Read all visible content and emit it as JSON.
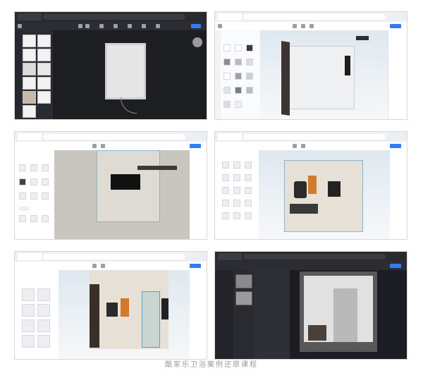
{
  "caption": "酷家乐卫浴案例还原课程",
  "screenshots": [
    {
      "id": "shot-1",
      "theme": "dark",
      "view": "floor-plan-2d"
    },
    {
      "id": "shot-2",
      "theme": "light",
      "view": "3d-walls"
    },
    {
      "id": "shot-3",
      "theme": "light",
      "view": "top-view-furnishing"
    },
    {
      "id": "shot-4",
      "theme": "light",
      "view": "3d-furnished"
    },
    {
      "id": "shot-5",
      "theme": "light",
      "view": "3d-shower-glass"
    },
    {
      "id": "shot-6",
      "theme": "dark",
      "view": "render-result"
    }
  ],
  "colors": {
    "accent": "#2f7df6",
    "dark_ui": "#1f2025",
    "light_ui": "#ffffff",
    "tile_white": "#eef0f2",
    "door_brown": "#4a3a30"
  }
}
